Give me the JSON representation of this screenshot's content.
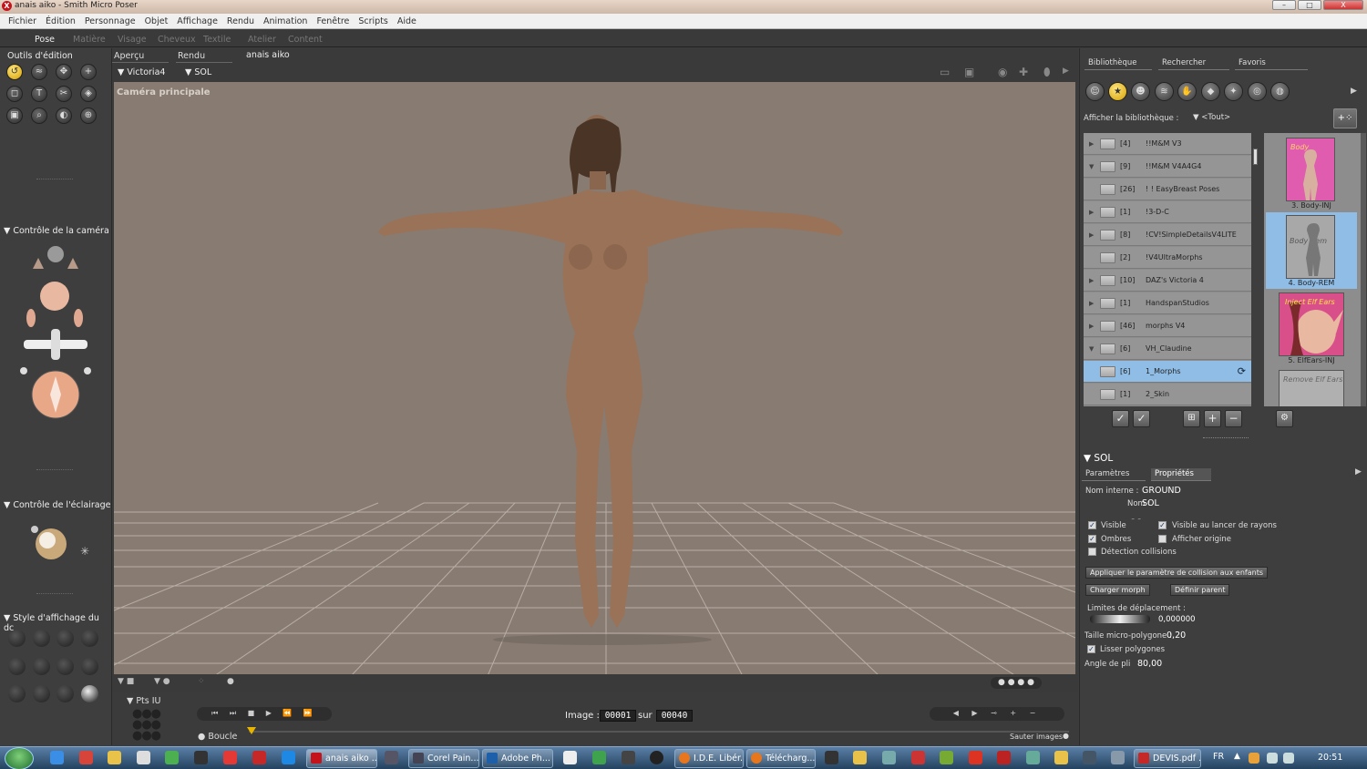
{
  "window": {
    "title": "anais aiko - Smith Micro Poser",
    "app_icon": "poser-x-icon",
    "minimize": "–",
    "maximize": "□",
    "close": "X"
  },
  "menu": [
    "Fichier",
    "Édition",
    "Personnage",
    "Objet",
    "Affichage",
    "Rendu",
    "Animation",
    "Fenêtre",
    "Scripts",
    "Aide"
  ],
  "rooms": [
    "Pose",
    "Matière",
    "Visage",
    "Cheveux",
    "Textile",
    "Atelier",
    "Content"
  ],
  "left": {
    "editing_tools_title": "Outils d'édition",
    "camera_title": "Contrôle de la caméra",
    "light_title": "Contrôle de l'éclairage",
    "display_title": "Style d'affichage du dc"
  },
  "viewport": {
    "tabs": [
      "Aperçu",
      "Rendu"
    ],
    "doc_title": "anais aiko",
    "figure_select": "Victoria4",
    "actor_select": "SOL",
    "camera_label": "Caméra principale"
  },
  "animation": {
    "keyframes_label": "Pts IU",
    "loop_label": "Boucle",
    "frame_label": "Image :",
    "frame_current": "00001",
    "frame_sep": "sur",
    "frame_total": "00040",
    "skip_label": "Sauter images"
  },
  "library": {
    "tabs": [
      "Bibliothèque",
      "Rechercher",
      "Favoris"
    ],
    "show_label": "Afficher la bibliothèque :",
    "show_value": "<Tout>",
    "folders": [
      {
        "exp": "▶",
        "count": "[4]",
        "name": "!!M&M V3"
      },
      {
        "exp": "▼",
        "count": "[9]",
        "name": "!!M&M V4A4G4"
      },
      {
        "exp": "",
        "count": "[26]",
        "name": "! ! EasyBreast Poses"
      },
      {
        "exp": "▶",
        "count": "[1]",
        "name": "!3-D-C"
      },
      {
        "exp": "▶",
        "count": "[8]",
        "name": "!CV!SimpleDetailsV4LITE"
      },
      {
        "exp": "",
        "count": "[2]",
        "name": "!V4UltraMorphs"
      },
      {
        "exp": "▶",
        "count": "[10]",
        "name": "DAZ's Victoria 4"
      },
      {
        "exp": "▶",
        "count": "[1]",
        "name": "HandspanStudios"
      },
      {
        "exp": "▶",
        "count": "[46]",
        "name": "morphs V4"
      },
      {
        "exp": "▼",
        "count": "[6]",
        "name": "VH_Claudine"
      },
      {
        "exp": "",
        "count": "[6]",
        "name": "1_Morphs"
      },
      {
        "exp": "",
        "count": "[1]",
        "name": "2_Skin"
      }
    ],
    "thumbs": [
      {
        "label": "3. Body-INJ",
        "caption": "Body"
      },
      {
        "label": "4. Body-REM",
        "caption": "Body Rem"
      },
      {
        "label": "5. ElfEars-INJ",
        "caption": "Inject Elf Ears"
      },
      {
        "label": "",
        "caption": "Remove Elf Ears"
      }
    ]
  },
  "props": {
    "section": "SOL",
    "tabs": [
      "Paramètres",
      "Propriétés"
    ],
    "internal_name_label": "Nom interne :",
    "internal_name": "GROUND",
    "name_label": "Nom :",
    "name": "SOL",
    "visible": "Visible",
    "visible_raytrace": "Visible au lancer de rayons",
    "shadows": "Ombres",
    "show_origin": "Afficher origine",
    "collision": "Détection collisions",
    "apply_collision_btn": "Appliquer le paramètre de collision aux enfants",
    "load_morph_btn": "Charger morph",
    "set_parent_btn": "Définir parent",
    "displacement_label": "Limites de déplacement :",
    "displacement_value": "0,000000",
    "micropoly_label": "Taille micro-polygone :",
    "micropoly_value": "0,20",
    "smooth_label": "Lisser polygones",
    "crease_label": "Angle de pli",
    "crease_value": "80,00"
  },
  "taskbar": {
    "tasks": [
      "anais aiko ...",
      "Corel Pain...",
      "Adobe Ph...",
      "I.D.E. Libér...",
      "Télécharg...",
      "DEVIS.pdf ..."
    ],
    "lang": "FR",
    "clock": "20:51"
  },
  "colors": {
    "accent_yellow": "#e8b400",
    "selection_blue": "#8fbde6",
    "viewport_bg": "#877b72"
  }
}
